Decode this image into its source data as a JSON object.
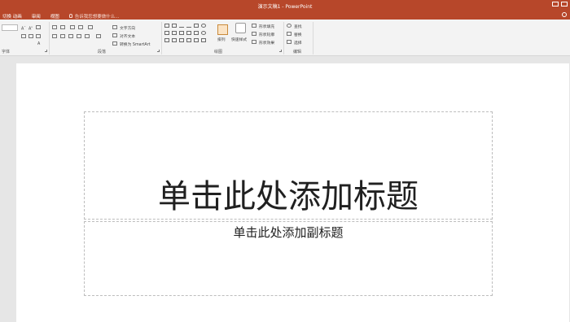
{
  "window": {
    "title": "演示文稿1 - PowerPoint"
  },
  "tabs": [
    {
      "label": "切换 动画"
    },
    {
      "label": "审阅"
    },
    {
      "label": "视图"
    }
  ],
  "tell_me": {
    "placeholder": "告诉我您想要做什么..."
  },
  "ribbon": {
    "groups": {
      "font": "字体",
      "paragraph": "段落",
      "drawing": "绘图",
      "editing": "编辑"
    },
    "paragraph_buttons": {
      "text_direction": "文字方向",
      "align_text": "对齐文本",
      "convert_smartart": "转换为 SmartArt"
    },
    "drawing_buttons": {
      "arrange": "排列",
      "quick_styles": "快速样式",
      "shape_fill": "形状填充",
      "shape_outline": "形状轮廓",
      "shape_effects": "形状效果"
    },
    "editing_buttons": {
      "find": "查找",
      "replace": "替换",
      "select": "选择"
    }
  },
  "slide": {
    "title_placeholder": "单击此处添加标题",
    "subtitle_placeholder": "单击此处添加副标题"
  },
  "colors": {
    "accent": "#b7472a",
    "ribbon_bg": "#f3f3f3",
    "canvas_bg": "#e6e6e6"
  }
}
